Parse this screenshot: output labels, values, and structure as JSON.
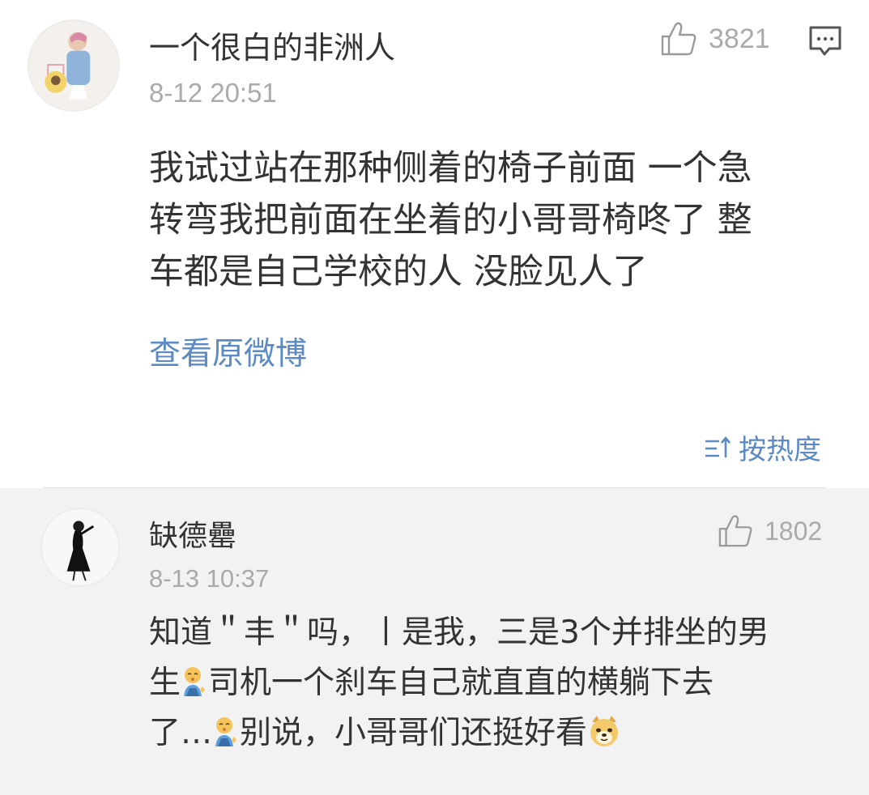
{
  "main_comment": {
    "username": "一个很白的非洲人",
    "time": "8-12 20:51",
    "like_count": "3821",
    "text_lines": [
      "我试过站在那种侧着的椅子前面 一个急",
      "转弯我把前面在坐着的小哥哥椅咚了 整",
      "车都是自己学校的人 没脸见人了"
    ],
    "view_original": "查看原微博",
    "icons": {
      "like": "thumbs-up-icon",
      "reply": "comment-icon",
      "avatar": "user-avatar"
    }
  },
  "sort": {
    "label": "按热度",
    "icon": "sort-icon"
  },
  "sub_comment": {
    "username": "缺德罍",
    "time": "8-13 10:37",
    "like_count": "1802",
    "text_parts": {
      "line1": "知道＂丰＂吗，丨是我，三是3个并排坐的男",
      "line2a": "生",
      "line2b": "司机一个刹车自己就直直的横躺下去",
      "line3a": "了…",
      "line3b": "别说，小哥哥们还挺好看"
    },
    "emojis": [
      "sleepy-person-emoji",
      "sleepy-person-emoji",
      "doge-emoji"
    ]
  },
  "colors": {
    "link": "#5b8ac4",
    "meta": "#aaaaaa",
    "text": "#333333",
    "sub_bg": "#f2f2f2"
  }
}
